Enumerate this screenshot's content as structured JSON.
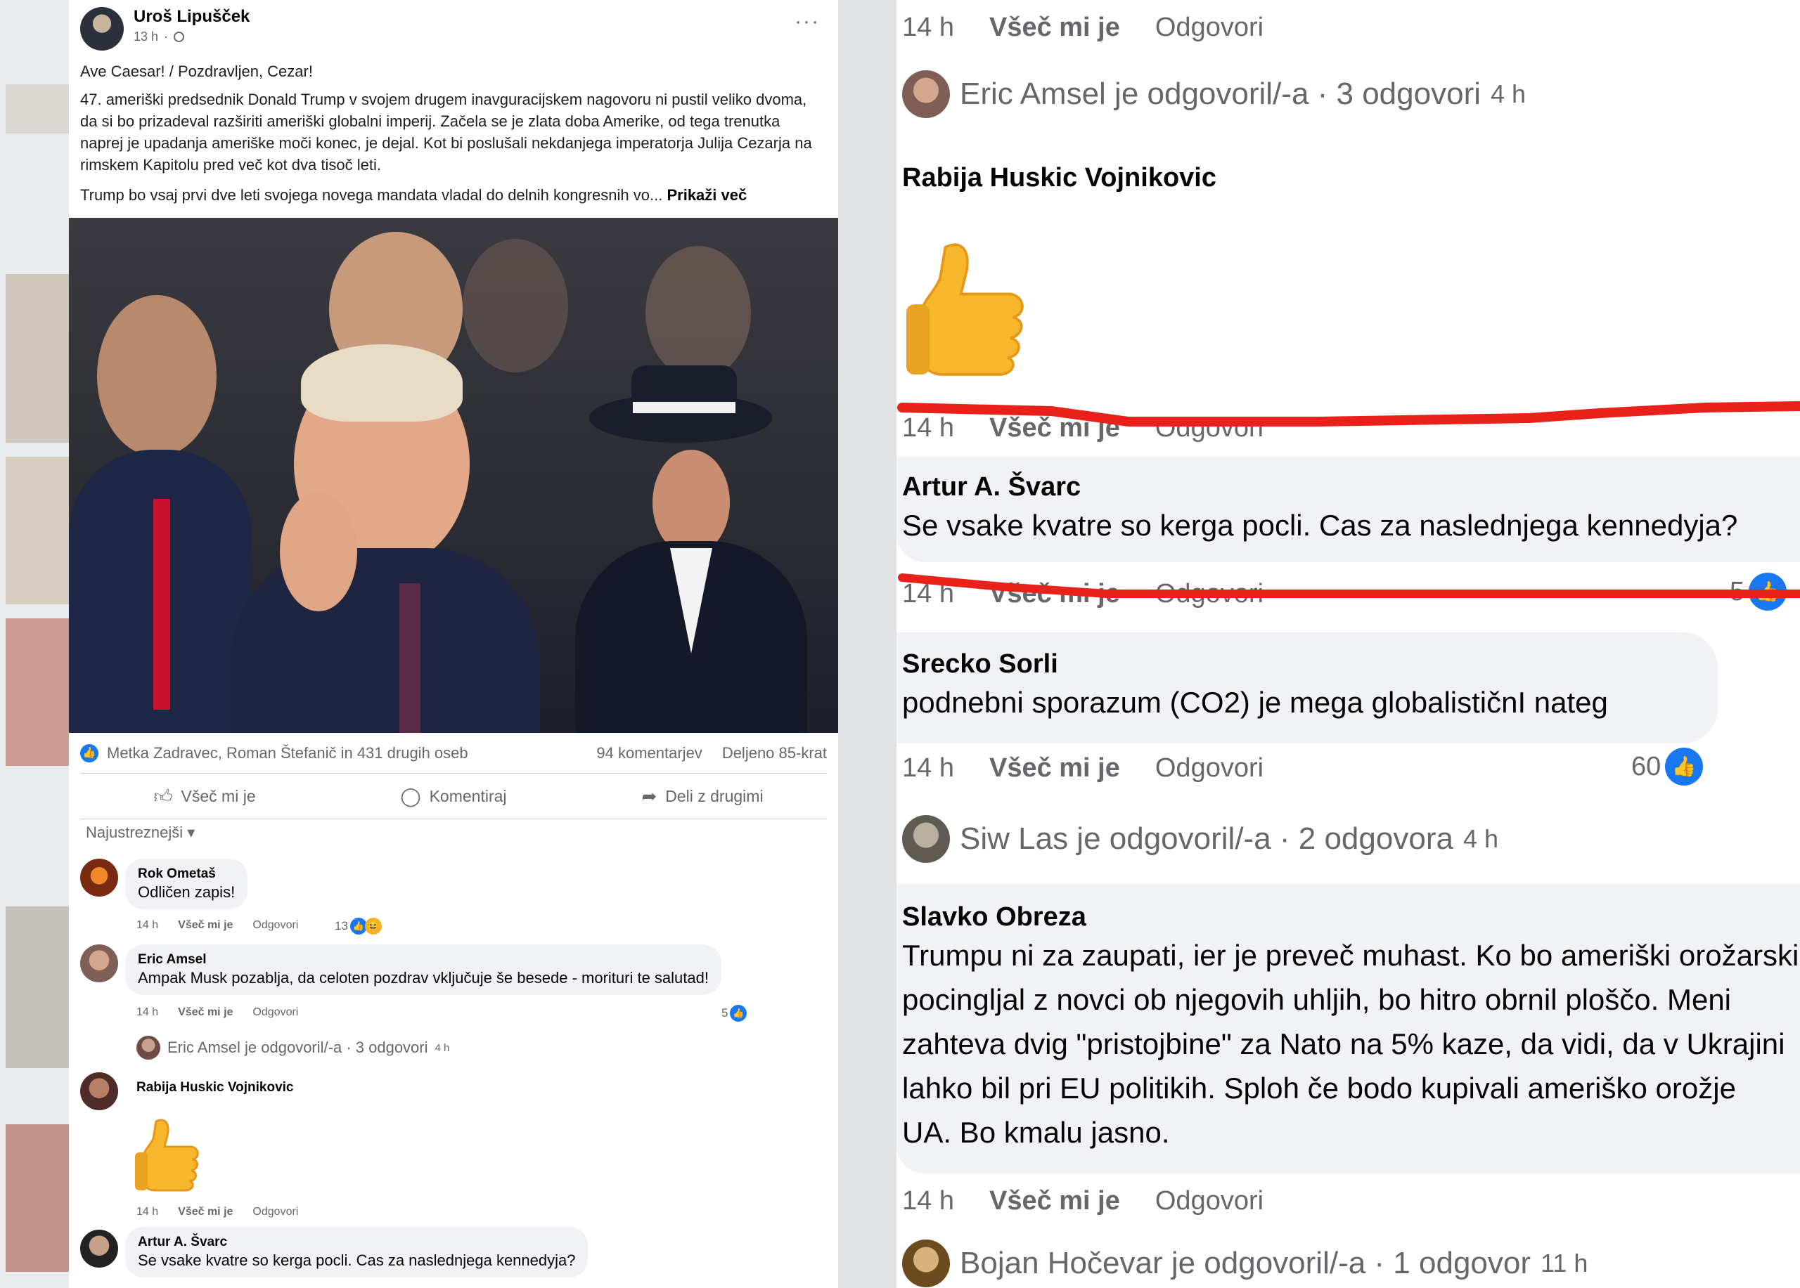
{
  "post": {
    "author": "Uroš Lipušček",
    "time": "13 h",
    "greeting": "Ave Caesar! / Pozdravljen, Cezar!",
    "body": "47. ameriški predsednik Donald Trump v svojem drugem inavguracijskem nagovoru ni pustil veliko dvoma, da si bo prizadeval razširiti ameriški globalni imperij. Začela se je zlata doba Amerike, od tega trenutka naprej je upadanja ameriške moči konec, je dejal. Kot bi poslušali nekdanjega imperatorja Julija Cezarja na rimskem Kapitolu pred več kot dva tisoč leti.",
    "body2": "Trump bo vsaj prvi dve leti svojega novega mandata vladal do delnih kongresnih vo...",
    "see_more": "Prikaži več",
    "reactions_text": "Metka Zadravec, Roman Štefanič in 431 drugih oseb",
    "comments_count": "94 komentarjev",
    "shares_count": "Deljeno 85-krat",
    "actions": {
      "like": "Všeč mi je",
      "comment": "Komentiraj",
      "share": "Deli z drugimi"
    },
    "sort_label": "Najustreznejši"
  },
  "left_comments": [
    {
      "name": "Rok Ometaš",
      "text": "Odličen zapis!",
      "time": "14 h",
      "like": "Všeč mi je",
      "reply": "Odgovori",
      "count": "13"
    },
    {
      "name": "Eric Amsel",
      "text": "Ampak Musk pozablja, da celoten pozdrav vključuje še besede - morituri te salutad!",
      "time": "14 h",
      "like": "Všeč mi je",
      "reply": "Odgovori",
      "count": "5"
    },
    {
      "name": "Rabija Huskic Vojnikovic",
      "text": "",
      "time": "14 h",
      "like": "Všeč mi je",
      "reply": "Odgovori",
      "count": ""
    },
    {
      "name": "Artur A. Švarc",
      "text": "Se vsake kvatre so kerga pocli. Cas za naslednjega kennedyja?",
      "time": "",
      "like": "",
      "reply": "",
      "count": ""
    }
  ],
  "left_reply_summary": {
    "text": "Eric Amsel je odgovoril/-a · 3 odgovori",
    "ago": "4 h"
  },
  "right": {
    "top_meta": {
      "time": "14 h",
      "like": "Všeč mi je",
      "reply": "Odgovori"
    },
    "eric_reply": {
      "text": "Eric Amsel je odgovoril/-a · 3 odgovori",
      "ago": "4 h"
    },
    "rabija": {
      "name": "Rabija Huskic Vojnikovic",
      "time": "14 h",
      "like": "Všeč mi je",
      "reply": "Odgovori"
    },
    "artur": {
      "name": "Artur A. Švarc",
      "text": "Se vsake kvatre so kerga pocli. Cas za naslednjega kennedyja?",
      "time": "14 h",
      "like": "Všeč mi je",
      "reply": "Odgovori",
      "count": "5"
    },
    "srecko": {
      "name": "Srecko Sorli",
      "text": "podnebni sporazum (CO2) je mega globalističnI nateg",
      "time": "14 h",
      "like": "Všeč mi je",
      "reply": "Odgovori",
      "count": "60"
    },
    "siw_reply": {
      "text": "Siw Las je odgovoril/-a · 2 odgovora",
      "ago": "4 h"
    },
    "slavko": {
      "name": "Slavko Obreza",
      "lines": [
        "Trumpu ni za zaupati, ier je preveč muhast. Ko bo ameriški orožarski lobi",
        "pocingljal z novci ob njegovih uhljih, bo hitro obrnil ploščo. Meni",
        "zahteva dvig \"pristojbine\" za Nato na 5% kaze, da vidi, da v Ukrajini",
        "lahko bil pri EU politikih. Sploh če bodo kupivali ameriško orožje",
        "UA. Bo kmalu jasno."
      ],
      "time": "14 h",
      "like": "Všeč mi je",
      "reply": "Odgovori"
    },
    "bojan_reply": {
      "text": "Bojan Hočevar je odgovoril/-a · 1 odgovor",
      "ago": "11 h"
    }
  },
  "colors": {
    "facebook_blue": "#1877f2",
    "strike_red": "#e8211b",
    "bubble_gray": "#f0f2f5",
    "meta_gray": "#65676b"
  },
  "icons": [
    "more-options-icon",
    "globe-icon",
    "like-reaction-icon",
    "haha-reaction-icon",
    "thumbs-up-emoji-icon",
    "comment-icon",
    "share-icon",
    "chevron-down-icon"
  ]
}
